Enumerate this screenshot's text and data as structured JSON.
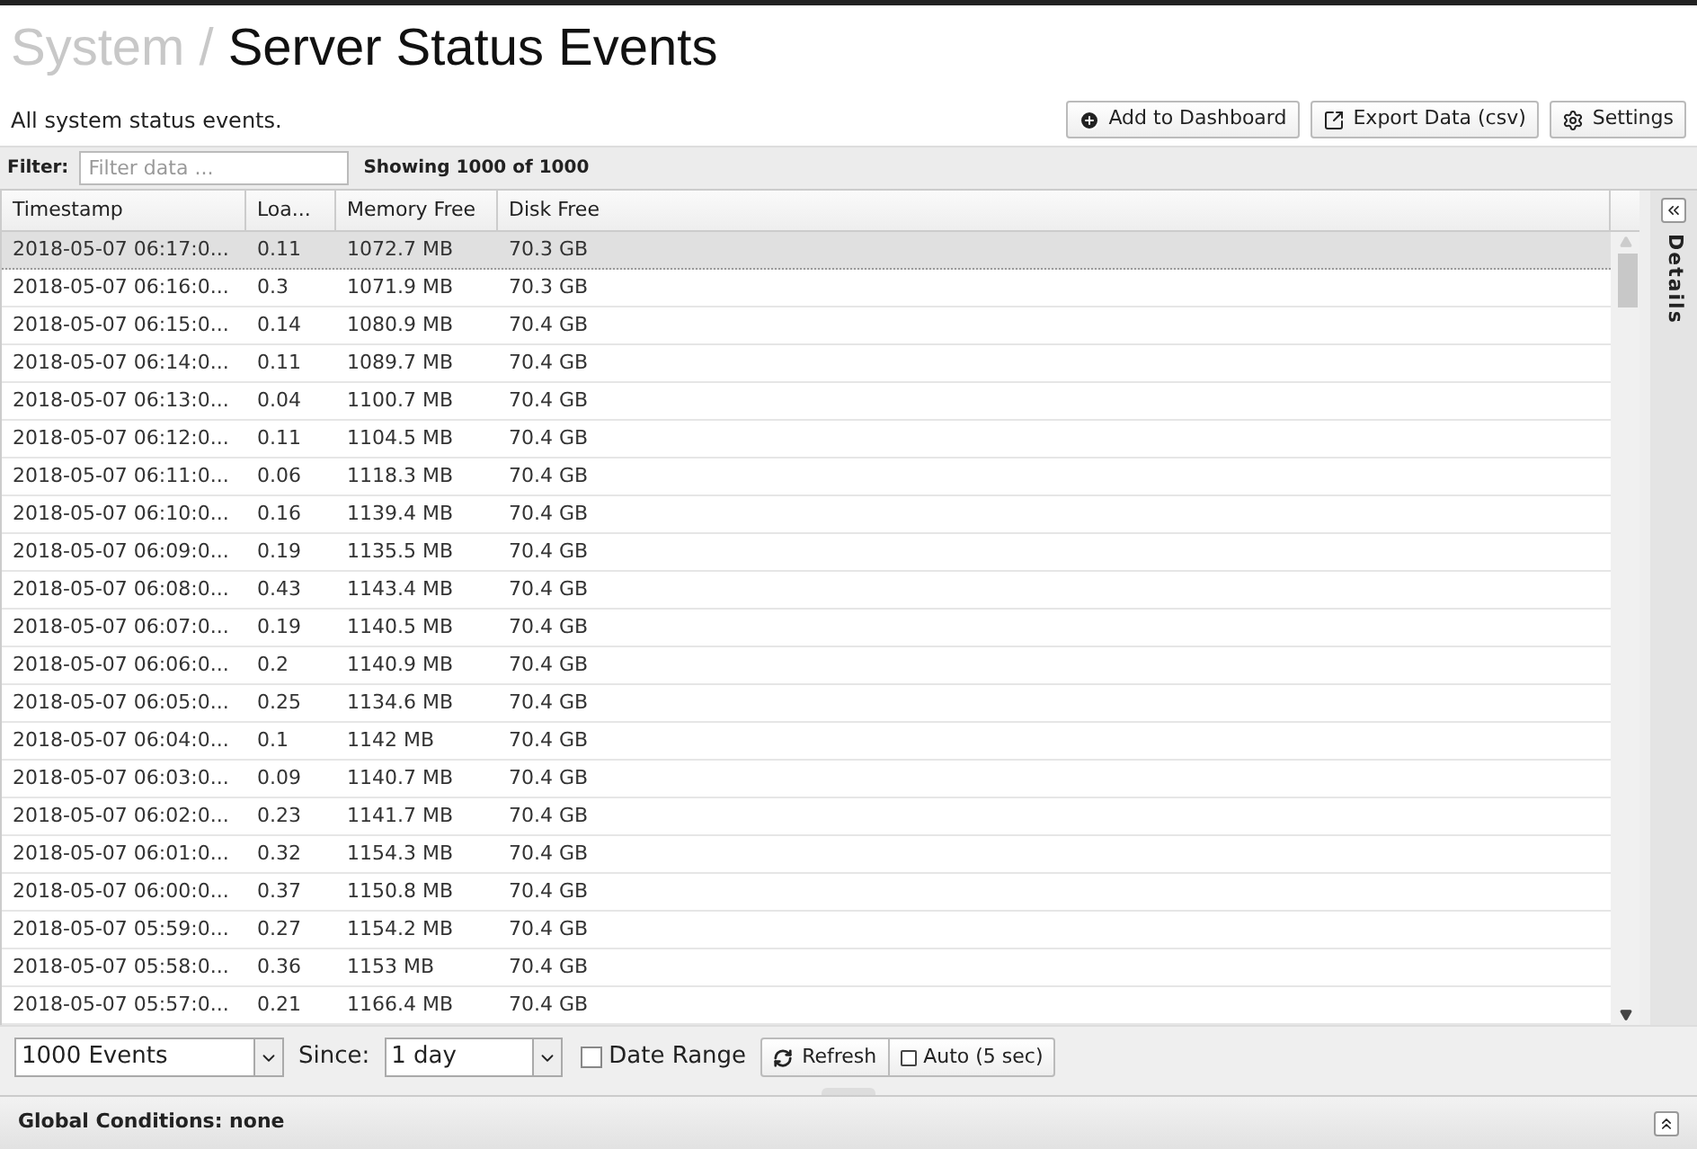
{
  "breadcrumb": "System /",
  "title": "Server Status Events",
  "subtitle": "All system status events.",
  "actions": [
    {
      "label": "Add to Dashboard",
      "kind": "add"
    },
    {
      "label": "Export Data (csv)",
      "kind": "export"
    },
    {
      "label": "Settings",
      "kind": "settings"
    }
  ],
  "filter": {
    "label": "Filter:",
    "placeholder": "Filter data ...",
    "summary": "Showing 1000 of 1000"
  },
  "table": {
    "columns": [
      "Timestamp",
      "Loa...",
      "Memory Free",
      "Disk Free"
    ],
    "rows": [
      {
        "cells": [
          "2018-05-07 06:17:0...",
          "0.11",
          "1072.7 MB",
          "70.3 GB"
        ],
        "selected": true
      },
      {
        "cells": [
          "2018-05-07 06:16:0...",
          "0.3",
          "1071.9 MB",
          "70.3 GB"
        ],
        "selected": false
      },
      {
        "cells": [
          "2018-05-07 06:15:0...",
          "0.14",
          "1080.9 MB",
          "70.4 GB"
        ],
        "selected": false
      },
      {
        "cells": [
          "2018-05-07 06:14:0...",
          "0.11",
          "1089.7 MB",
          "70.4 GB"
        ],
        "selected": false
      },
      {
        "cells": [
          "2018-05-07 06:13:0...",
          "0.04",
          "1100.7 MB",
          "70.4 GB"
        ],
        "selected": false
      },
      {
        "cells": [
          "2018-05-07 06:12:0...",
          "0.11",
          "1104.5 MB",
          "70.4 GB"
        ],
        "selected": false
      },
      {
        "cells": [
          "2018-05-07 06:11:0...",
          "0.06",
          "1118.3 MB",
          "70.4 GB"
        ],
        "selected": false
      },
      {
        "cells": [
          "2018-05-07 06:10:0...",
          "0.16",
          "1139.4 MB",
          "70.4 GB"
        ],
        "selected": false
      },
      {
        "cells": [
          "2018-05-07 06:09:0...",
          "0.19",
          "1135.5 MB",
          "70.4 GB"
        ],
        "selected": false
      },
      {
        "cells": [
          "2018-05-07 06:08:0...",
          "0.43",
          "1143.4 MB",
          "70.4 GB"
        ],
        "selected": false
      },
      {
        "cells": [
          "2018-05-07 06:07:0...",
          "0.19",
          "1140.5 MB",
          "70.4 GB"
        ],
        "selected": false
      },
      {
        "cells": [
          "2018-05-07 06:06:0...",
          "0.2",
          "1140.9 MB",
          "70.4 GB"
        ],
        "selected": false
      },
      {
        "cells": [
          "2018-05-07 06:05:0...",
          "0.25",
          "1134.6 MB",
          "70.4 GB"
        ],
        "selected": false
      },
      {
        "cells": [
          "2018-05-07 06:04:0...",
          "0.1",
          "1142 MB",
          "70.4 GB"
        ],
        "selected": false
      },
      {
        "cells": [
          "2018-05-07 06:03:0...",
          "0.09",
          "1140.7 MB",
          "70.4 GB"
        ],
        "selected": false
      },
      {
        "cells": [
          "2018-05-07 06:02:0...",
          "0.23",
          "1141.7 MB",
          "70.4 GB"
        ],
        "selected": false
      },
      {
        "cells": [
          "2018-05-07 06:01:0...",
          "0.32",
          "1154.3 MB",
          "70.4 GB"
        ],
        "selected": false
      },
      {
        "cells": [
          "2018-05-07 06:00:0...",
          "0.37",
          "1150.8 MB",
          "70.4 GB"
        ],
        "selected": false
      },
      {
        "cells": [
          "2018-05-07 05:59:0...",
          "0.27",
          "1154.2 MB",
          "70.4 GB"
        ],
        "selected": false
      },
      {
        "cells": [
          "2018-05-07 05:58:0...",
          "0.36",
          "1153 MB",
          "70.4 GB"
        ],
        "selected": false
      },
      {
        "cells": [
          "2018-05-07 05:57:0...",
          "0.21",
          "1166.4 MB",
          "70.4 GB"
        ],
        "selected": false
      }
    ]
  },
  "details_tab": "Details",
  "controls": {
    "count": "1000 Events",
    "since_label": "Since:",
    "since": "1 day",
    "date_range": {
      "label": "Date Range",
      "checked": false
    },
    "refresh": "Refresh",
    "auto": {
      "label": "Auto (5 sec)",
      "checked": false
    }
  },
  "global_conditions": "Global Conditions: none"
}
